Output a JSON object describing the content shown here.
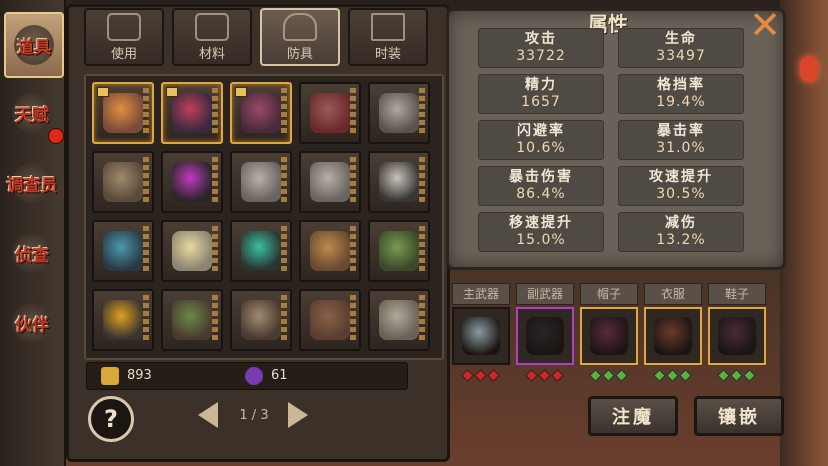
{
  "left_tabs": [
    {
      "label": "道具",
      "active": true,
      "badge": false
    },
    {
      "label": "天赋",
      "active": false,
      "badge": true
    },
    {
      "label": "调查员",
      "active": false,
      "badge": false
    },
    {
      "label": "侦查",
      "active": false,
      "badge": false
    },
    {
      "label": "伙伴",
      "active": false,
      "badge": false
    }
  ],
  "top_tabs": [
    {
      "label": "使用",
      "icon": "bottle-icon",
      "active": false
    },
    {
      "label": "材料",
      "icon": "material-icon",
      "active": false
    },
    {
      "label": "防具",
      "icon": "helmet-icon",
      "active": true
    },
    {
      "label": "时装",
      "icon": "top-hat-icon",
      "active": false
    }
  ],
  "items": [
    {
      "kind": "armor-armored-figure",
      "color": "#7a4a3a",
      "accent": "#e09040",
      "gold": true,
      "flag": true
    },
    {
      "kind": "armor-dark-crab",
      "color": "#3a2a40",
      "accent": "#c0405a",
      "gold": true,
      "flag": true
    },
    {
      "kind": "armor-claw-piece",
      "color": "#4a2a3a",
      "accent": "#9a4a6a",
      "gold": true,
      "flag": true
    },
    {
      "kind": "armor-red-vest",
      "color": "#6a2a2a",
      "accent": "#9a5a5a",
      "gold": false,
      "flag": false
    },
    {
      "kind": "armor-bandaged-torso",
      "color": "#5a5450",
      "accent": "#b0a8a0",
      "gold": false,
      "flag": false
    },
    {
      "kind": "armor-wrapped-arm",
      "color": "#5a4a3a",
      "accent": "#a08a6a",
      "gold": false,
      "flag": false
    },
    {
      "kind": "armor-black-glove",
      "color": "#2a2628",
      "accent": "#c03ac0",
      "gold": false,
      "flag": false
    },
    {
      "kind": "armor-bone-claws",
      "color": "#6a6460",
      "accent": "#b8b0a8",
      "gold": false,
      "flag": false
    },
    {
      "kind": "armor-bone-claws-2",
      "color": "#6a6460",
      "accent": "#b8b0a8",
      "gold": false,
      "flag": false
    },
    {
      "kind": "armor-skull-mask",
      "color": "#3a3634",
      "accent": "#c8c2ba",
      "gold": false,
      "flag": false
    },
    {
      "kind": "armor-winged-helm",
      "color": "#2a3a44",
      "accent": "#4a9ab0",
      "gold": false,
      "flag": false
    },
    {
      "kind": "armor-crown",
      "color": "#8a8470",
      "accent": "#e8d8a0",
      "gold": false,
      "flag": false
    },
    {
      "kind": "armor-eye-helm",
      "color": "#2a3432",
      "accent": "#3ac0a0",
      "gold": false,
      "flag": false
    },
    {
      "kind": "armor-bandana",
      "color": "#6a4a30",
      "accent": "#c08a50",
      "gold": false,
      "flag": false
    },
    {
      "kind": "armor-vine-mass",
      "color": "#3a4a2a",
      "accent": "#7a9a50",
      "gold": false,
      "flag": false
    },
    {
      "kind": "armor-diving-helm",
      "color": "#3a3430",
      "accent": "#e0a020",
      "gold": false,
      "flag": false
    },
    {
      "kind": "armor-boots",
      "color": "#4a3a2e",
      "accent": "#6a8a4a",
      "gold": false,
      "flag": false
    },
    {
      "kind": "armor-spiked-boots",
      "color": "#4a3a30",
      "accent": "#a08a70",
      "gold": false,
      "flag": false
    },
    {
      "kind": "armor-leather-boots",
      "color": "#5a3e30",
      "accent": "#8a6048",
      "gold": false,
      "flag": false
    },
    {
      "kind": "armor-wrapped-boots",
      "color": "#6a6258",
      "accent": "#b0a898",
      "gold": false,
      "flag": false
    }
  ],
  "currency": [
    {
      "icon": "gold-scroll-icon",
      "color": "#d8a838",
      "value": "893"
    },
    {
      "icon": "purple-gem-icon",
      "color": "#7a3ab0",
      "value": "61"
    }
  ],
  "pager": {
    "text": "1 / 3"
  },
  "help": {
    "label": "?"
  },
  "attributes": {
    "title": "属性",
    "stats": [
      {
        "name": "攻击",
        "value": "33722"
      },
      {
        "name": "生命",
        "value": "33497"
      },
      {
        "name": "精力",
        "value": "1657"
      },
      {
        "name": "格挡率",
        "value": "19.4%"
      },
      {
        "name": "闪避率",
        "value": "10.6%"
      },
      {
        "name": "暴击率",
        "value": "31.0%"
      },
      {
        "name": "暴击伤害",
        "value": "86.4%"
      },
      {
        "name": "攻速提升",
        "value": "30.5%"
      },
      {
        "name": "移速提升",
        "value": "15.0%"
      },
      {
        "name": "减伤",
        "value": "13.2%"
      }
    ]
  },
  "close": {
    "label": "✕"
  },
  "equipped": [
    {
      "label": "主武器",
      "border": "#1a1512",
      "item": "#8a9aa0",
      "dots": "red"
    },
    {
      "label": "副武器",
      "border": "#b040c0",
      "item": "#2a2428",
      "dots": "red"
    },
    {
      "label": "帽子",
      "border": "#e0a640",
      "item": "#5a2a3a",
      "dots": "green"
    },
    {
      "label": "衣服",
      "border": "#e0a640",
      "item": "#6a3a2a",
      "dots": "green"
    },
    {
      "label": "鞋子",
      "border": "#e0a640",
      "item": "#4a2a3a",
      "dots": "green"
    }
  ],
  "colors": {
    "dot_red": "#d02828",
    "dot_green": "#58b040"
  },
  "actions": {
    "enchant": "注魔",
    "inlay": "镶嵌"
  }
}
